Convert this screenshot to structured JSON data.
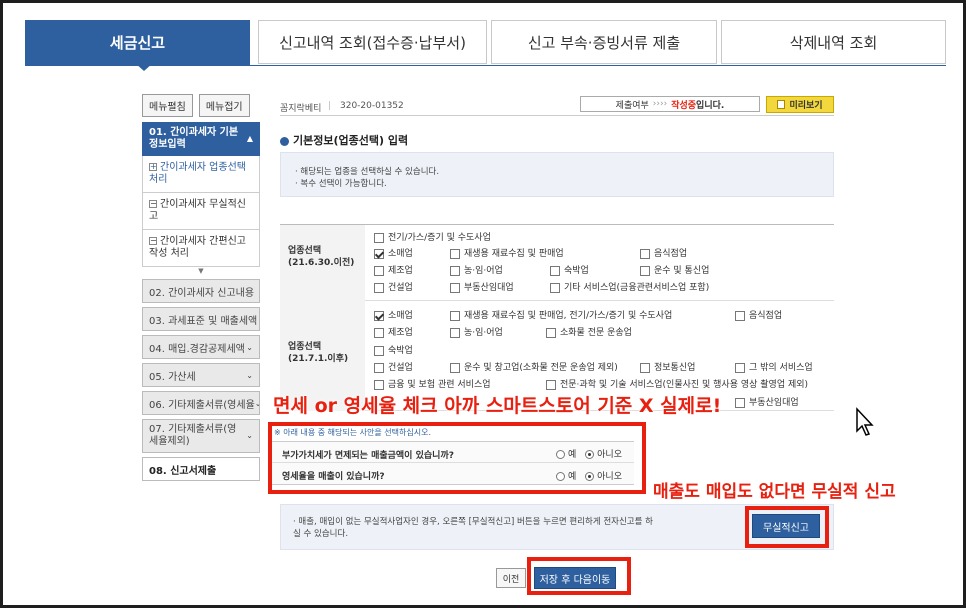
{
  "tabs": [
    {
      "label": "세금신고"
    },
    {
      "label": "신고내역 조회(접수증·납부서)"
    },
    {
      "label": "신고 부속·증빙서류 제출"
    },
    {
      "label": "삭제내역 조회"
    }
  ],
  "sidebar": {
    "expand_label": "메뉴펼침",
    "collapse_label": "메뉴접기",
    "steps": [
      {
        "label": "01. 간이과세자 기본정보입력"
      },
      {
        "label": "02. 간이과세자 신고내용"
      },
      {
        "label": "03. 과세표준 및 매출세액"
      },
      {
        "label": "04. 매입.경감공제세액"
      },
      {
        "label": "05. 가산세"
      },
      {
        "label": "06. 기타제출서류(영세율"
      },
      {
        "label": "07. 기타제출서류(영세율제외)"
      },
      {
        "label": "08. 신고서제출"
      }
    ],
    "subitems": [
      {
        "label": "간이과세자 업종선택처리"
      },
      {
        "label": "간이과세자 무실적신고"
      },
      {
        "label": "간이과세자 간편신고작성 처리"
      }
    ]
  },
  "header": {
    "company": "꼼지락베티",
    "bizno": "320-20-01352",
    "status_label": "제출여부",
    "status_arrows": "››››",
    "status_value": "작성중",
    "status_suffix": "입니다.",
    "preview_label": "미리보기"
  },
  "section": {
    "title": "기본정보(업종선택) 입력",
    "notes": [
      "해당되는 업종을 선택하실 수 있습니다.",
      "복수 선택이 가능합니다."
    ]
  },
  "group1": {
    "label": "업종선택\n(21.6.30.이전)",
    "options": [
      {
        "label": "전기/가스/증기 및 수도사업",
        "checked": false
      },
      {
        "label": "소매업",
        "checked": true
      },
      {
        "label": "재생용 재료수집 및 판매업",
        "checked": false
      },
      {
        "label": "음식점업",
        "checked": false
      },
      {
        "label": "제조업",
        "checked": false
      },
      {
        "label": "농·임·어업",
        "checked": false
      },
      {
        "label": "숙박업",
        "checked": false
      },
      {
        "label": "운수 및 통신업",
        "checked": false
      },
      {
        "label": "건설업",
        "checked": false
      },
      {
        "label": "부동산임대업",
        "checked": false
      },
      {
        "label": "기타 서비스업(금융관련서비스업 포함)",
        "checked": false
      }
    ]
  },
  "group2": {
    "label": "업종선택\n(21.7.1.이후)",
    "options": [
      {
        "label": "소매업",
        "checked": true
      },
      {
        "label": "재생용 재료수집 및 판매업, 전기/가스/증기 및 수도사업",
        "checked": false
      },
      {
        "label": "음식점업",
        "checked": false
      },
      {
        "label": "제조업",
        "checked": false
      },
      {
        "label": "농·임·어업",
        "checked": false
      },
      {
        "label": "소화물 전문 운송업",
        "checked": false
      },
      {
        "label": "숙박업",
        "checked": false
      },
      {
        "label": "건설업",
        "checked": false
      },
      {
        "label": "운수 및 창고업(소화물 전문 운송업 제외)",
        "checked": false
      },
      {
        "label": "정보통신업",
        "checked": false
      },
      {
        "label": "그 밖의 서비스업",
        "checked": false
      },
      {
        "label": "금융 및 보험 관련 서비스업",
        "checked": false
      },
      {
        "label": "전문·과학 및 기술 서비스업(인물사진 및 행사용 영상 촬영업 제외)",
        "checked": false
      },
      {
        "label": "부동산임대업",
        "checked": false
      }
    ]
  },
  "questions": {
    "notice": "※ 아래 내용 중 해당되는 사안을 선택하십시오.",
    "items": [
      {
        "label": "부가가치세가 면제되는 매출금액이 있습니까?",
        "yes": "예",
        "no": "아니오",
        "selected": "no"
      },
      {
        "label": "영세율을 매출이 있습니까?",
        "yes": "예",
        "no": "아니오",
        "selected": "no"
      }
    ]
  },
  "nilreport": {
    "text": "매출, 매입이 없는 무실적사업자인 경우, 오른쪽 [무실적신고] 버튼을 누르면 편리하게 전자신고를 하실 수 있습니다.",
    "button": "무실적신고"
  },
  "footer": {
    "prev": "이전",
    "next": "저장 후 다음이동"
  },
  "annotations": {
    "a1": "면세 or 영세율 체크 아까 스마트스토어 기준 X 실제로!",
    "a2": "매출도 매입도 없다면 무실적 신고"
  },
  "colors": {
    "accent": "#2e5f9e",
    "annotation": "#e8200f"
  }
}
